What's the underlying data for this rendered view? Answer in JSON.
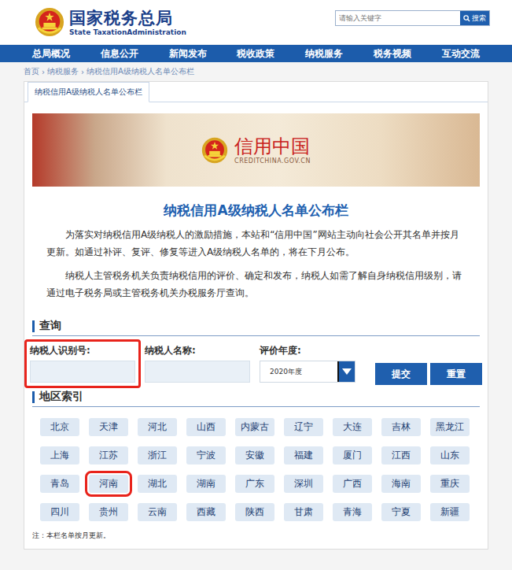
{
  "header": {
    "title": "国家税务总局",
    "subtitle": "State TaxationAdministration",
    "search": {
      "placeholder": "请输入关键字",
      "button": "搜索"
    }
  },
  "nav": [
    {
      "label": "总局概况"
    },
    {
      "label": "信息公开"
    },
    {
      "label": "新闻发布"
    },
    {
      "label": "税收政策"
    },
    {
      "label": "纳税服务"
    },
    {
      "label": "税务视频"
    },
    {
      "label": "互动交流"
    }
  ],
  "breadcrumb": {
    "separator": "›",
    "items": [
      "首页",
      "纳税服务",
      "纳税信用A级纳税人名单公布栏"
    ]
  },
  "tabs": [
    {
      "label": "纳税信用A级纳税人名单公布栏",
      "selected": true
    }
  ],
  "banner": {
    "title": "信用中国",
    "subtitle": "CREDITCHINA.GOV.CN"
  },
  "title": "纳税信用A级纳税人名单公布栏",
  "paragraphs": [
    "为落实对纳税信用A级纳税人的激励措施，本站和“信用中国”网站主动向社会公开其名单并按月更新。如通过补评、复评、修复等进入A级纳税人名单的，将在下月公布。",
    "纳税人主管税务机关负责纳税信用的评价、确定和发布，纳税人如需了解自身纳税信用级别，请通过电子税务局或主管税务机关办税服务厅查询。"
  ],
  "query": {
    "heading": "查询",
    "fields": [
      {
        "label": "纳税人识别号:",
        "kind": "input",
        "highlighted": true
      },
      {
        "label": "纳税人名称:",
        "kind": "input",
        "highlighted": false
      },
      {
        "label": "评价年度:",
        "kind": "select",
        "value": "2020年度",
        "highlighted": false
      }
    ],
    "buttons": [
      "提交",
      "重置"
    ]
  },
  "regions": {
    "heading": "地区索引",
    "items": [
      {
        "label": "北京",
        "highlighted": false
      },
      {
        "label": "天津",
        "highlighted": false
      },
      {
        "label": "河北",
        "highlighted": false
      },
      {
        "label": "山西",
        "highlighted": false
      },
      {
        "label": "内蒙古",
        "highlighted": false
      },
      {
        "label": "辽宁",
        "highlighted": false
      },
      {
        "label": "大连",
        "highlighted": false
      },
      {
        "label": "吉林",
        "highlighted": false
      },
      {
        "label": "黑龙江",
        "highlighted": false
      },
      {
        "label": "上海",
        "highlighted": false
      },
      {
        "label": "江苏",
        "highlighted": false
      },
      {
        "label": "浙江",
        "highlighted": false
      },
      {
        "label": "宁波",
        "highlighted": false
      },
      {
        "label": "安徽",
        "highlighted": false
      },
      {
        "label": "福建",
        "highlighted": false
      },
      {
        "label": "厦门",
        "highlighted": false
      },
      {
        "label": "江西",
        "highlighted": false
      },
      {
        "label": "山东",
        "highlighted": false
      },
      {
        "label": "青岛",
        "highlighted": false
      },
      {
        "label": "河南",
        "highlighted": true
      },
      {
        "label": "湖北",
        "highlighted": false
      },
      {
        "label": "湖南",
        "highlighted": false
      },
      {
        "label": "广东",
        "highlighted": false
      },
      {
        "label": "深圳",
        "highlighted": false
      },
      {
        "label": "广西",
        "highlighted": false
      },
      {
        "label": "海南",
        "highlighted": false
      },
      {
        "label": "重庆",
        "highlighted": false
      },
      {
        "label": "四川",
        "highlighted": false
      },
      {
        "label": "贵州",
        "highlighted": false
      },
      {
        "label": "云南",
        "highlighted": false
      },
      {
        "label": "西藏",
        "highlighted": false
      },
      {
        "label": "陕西",
        "highlighted": false
      },
      {
        "label": "甘肃",
        "highlighted": false
      },
      {
        "label": "青海",
        "highlighted": false
      },
      {
        "label": "宁夏",
        "highlighted": false
      },
      {
        "label": "新疆",
        "highlighted": false
      }
    ]
  },
  "note": "注：本栏名单按月更新。"
}
